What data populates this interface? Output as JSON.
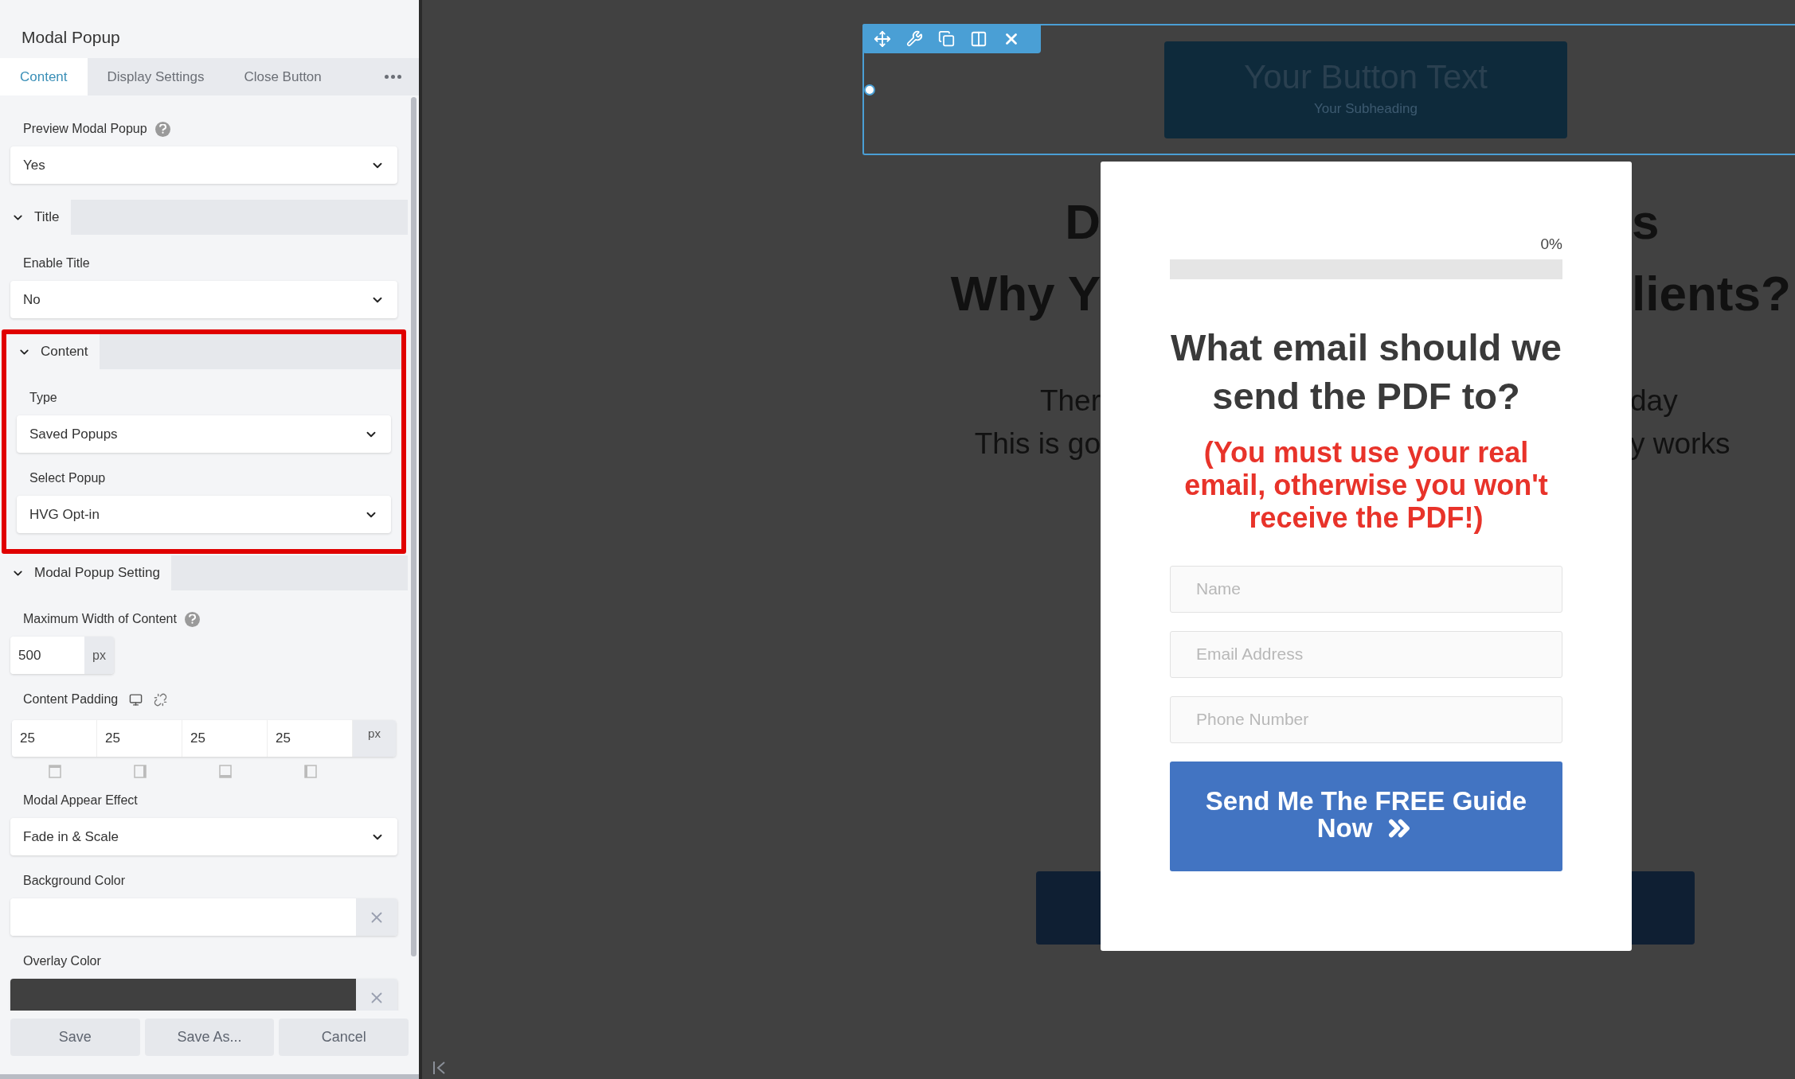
{
  "panel": {
    "title": "Modal Popup",
    "tabs": [
      {
        "label": "Content",
        "selected": true
      },
      {
        "label": "Display Settings",
        "selected": false
      },
      {
        "label": "Close Button",
        "selected": false
      }
    ],
    "top_fields": [
      {
        "kind": "select",
        "label": "Preview Modal Popup",
        "help": true,
        "value": "Yes"
      }
    ],
    "sections": [
      {
        "title": "Title",
        "expanded": true,
        "highlighted": false,
        "fields": [
          {
            "kind": "select",
            "label": "Enable Title",
            "help": false,
            "value": "No"
          }
        ]
      },
      {
        "title": "Content",
        "expanded": true,
        "highlighted": true,
        "fields": [
          {
            "kind": "select",
            "label": "Type",
            "help": false,
            "value": "Saved Popups"
          },
          {
            "kind": "select",
            "label": "Select Popup",
            "help": false,
            "value": "HVG Opt-in"
          }
        ]
      },
      {
        "title": "Modal Popup Setting",
        "expanded": true,
        "highlighted": false,
        "fields": [
          {
            "kind": "unit",
            "label": "Maximum Width of Content",
            "help": true,
            "value": "500",
            "unit": "px"
          },
          {
            "kind": "padding",
            "label": "Content Padding",
            "help": false,
            "values": [
              "25",
              "25",
              "25",
              "25"
            ],
            "unit": "px"
          },
          {
            "kind": "select",
            "label": "Modal Appear Effect",
            "help": false,
            "value": "Fade in & Scale"
          },
          {
            "kind": "color",
            "label": "Background Color",
            "help": false
          },
          {
            "kind": "color",
            "label": "Overlay Color",
            "help": false,
            "color": "#404040"
          }
        ]
      }
    ],
    "buttons": [
      "Save",
      "Save As...",
      "Cancel"
    ]
  },
  "canvas": {
    "module_button": {
      "text": "Your Button Text",
      "subheading": "Your Subheading"
    },
    "heading_lines": [
      {
        "left": "D",
        "right": "s"
      },
      {
        "left": "Why Y",
        "right": "lients?"
      }
    ],
    "paragraph_lines": [
      {
        "left": "Ther",
        "right": "day"
      },
      {
        "left": "This is go",
        "right": "y works"
      }
    ],
    "popup": {
      "progress": {
        "label": "0%",
        "level": 0
      },
      "heading": "What email should we send the PDF to?",
      "warning": "(You must use your real email, otherwise you won't receive the PDF!)",
      "fields": [
        {
          "placeholder": "Name"
        },
        {
          "placeholder": "Email Address"
        },
        {
          "placeholder": "Phone Number"
        }
      ],
      "submit": "Send Me The FREE Guide Now"
    }
  }
}
